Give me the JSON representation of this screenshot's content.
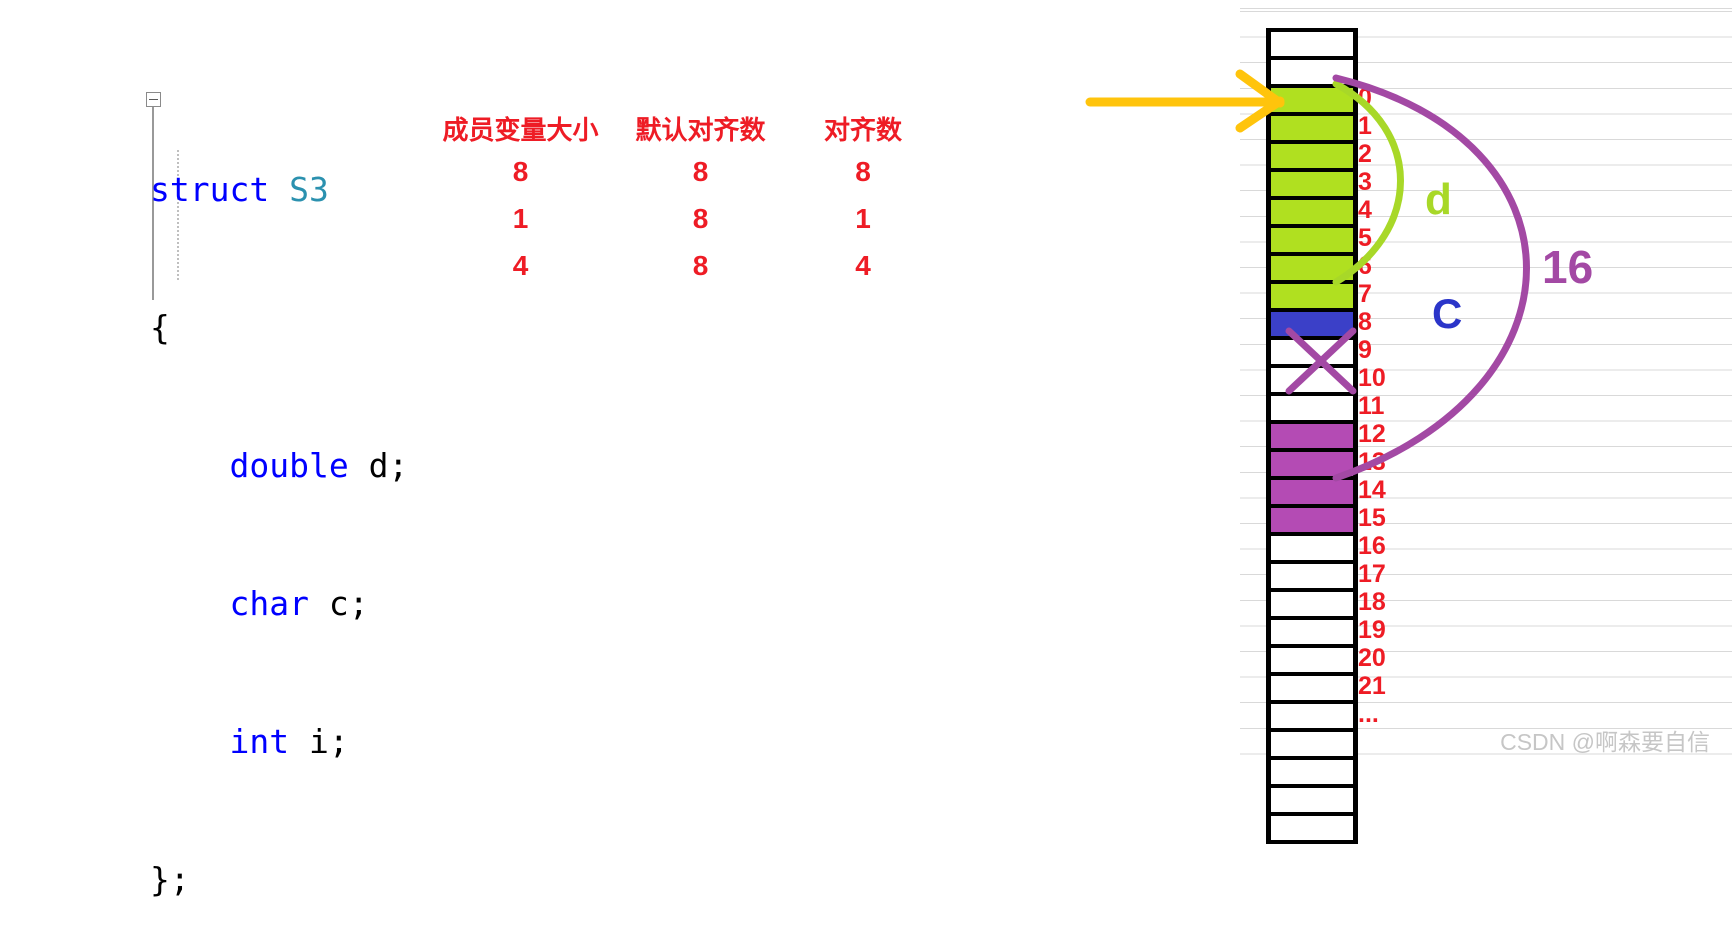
{
  "code": {
    "lines": [
      [
        {
          "t": "struct ",
          "c": "kw"
        },
        {
          "t": "S3",
          "c": "type"
        }
      ],
      [
        {
          "t": "{",
          "c": "plain"
        }
      ],
      [
        {
          "t": "    ",
          "c": "plain"
        },
        {
          "t": "double ",
          "c": "kw"
        },
        {
          "t": "d;",
          "c": "plain"
        }
      ],
      [
        {
          "t": "    ",
          "c": "plain"
        },
        {
          "t": "char ",
          "c": "kw"
        },
        {
          "t": "c;",
          "c": "plain"
        }
      ],
      [
        {
          "t": "    ",
          "c": "plain"
        },
        {
          "t": "int ",
          "c": "kw"
        },
        {
          "t": "i;",
          "c": "plain"
        }
      ],
      [
        {
          "t": "};",
          "c": "plain"
        }
      ]
    ],
    "collapse_icon": "collapse-minus-icon"
  },
  "table": {
    "headers": {
      "member_size": "成员变量大小",
      "default_align": "默认对齐数",
      "align": "对齐数"
    },
    "rows": [
      {
        "member_size": "8",
        "default_align": "8",
        "align": "8"
      },
      {
        "member_size": "1",
        "default_align": "8",
        "align": "1"
      },
      {
        "member_size": "4",
        "default_align": "8",
        "align": "4"
      }
    ]
  },
  "memory": {
    "cells": [
      {
        "fill": "white"
      },
      {
        "fill": "white"
      },
      {
        "fill": "green"
      },
      {
        "fill": "green"
      },
      {
        "fill": "green"
      },
      {
        "fill": "green"
      },
      {
        "fill": "green"
      },
      {
        "fill": "green"
      },
      {
        "fill": "green"
      },
      {
        "fill": "green"
      },
      {
        "fill": "blue"
      },
      {
        "fill": "white"
      },
      {
        "fill": "white"
      },
      {
        "fill": "white"
      },
      {
        "fill": "purple"
      },
      {
        "fill": "purple"
      },
      {
        "fill": "purple"
      },
      {
        "fill": "purple"
      },
      {
        "fill": "white"
      },
      {
        "fill": "white"
      },
      {
        "fill": "white"
      },
      {
        "fill": "white"
      },
      {
        "fill": "white"
      },
      {
        "fill": "white"
      },
      {
        "fill": "white"
      },
      {
        "fill": "white"
      },
      {
        "fill": "white"
      },
      {
        "fill": "white"
      },
      {
        "fill": "white"
      }
    ],
    "indices": [
      "0",
      "1",
      "2",
      "3",
      "4",
      "5",
      "6",
      "7",
      "8",
      "9",
      "10",
      "11",
      "12",
      "13",
      "14",
      "15",
      "16",
      "17",
      "18",
      "19",
      "20",
      "21",
      "..."
    ]
  },
  "annotations": {
    "d_label": "d",
    "c_label": "C",
    "total_label": "16",
    "start_arrow": "start-pointer-arrow",
    "x_mark": "padding-cross-icon"
  },
  "colors": {
    "green": "#b0e020",
    "blue": "#3b40c8",
    "purple": "#b44bb4",
    "red": "#ee1c25",
    "yellow": "#ffc40c",
    "curve_purple": "#a349a4"
  },
  "watermark": {
    "text": "CSDN @啊森要自信"
  }
}
